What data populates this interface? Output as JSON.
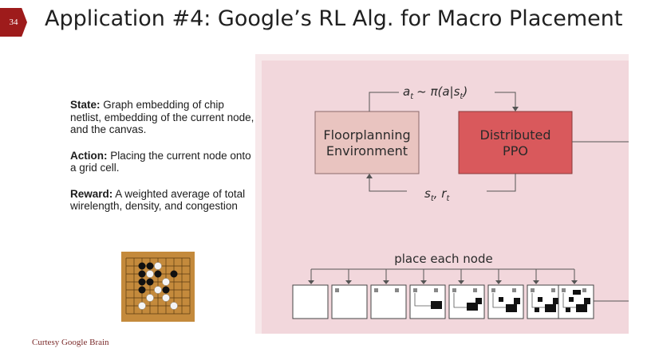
{
  "slide": {
    "number": "34",
    "title": "Application #4: Google’s RL Alg. for Macro Placement",
    "credit": "Curtesy Google Brain"
  },
  "definitions": {
    "state": {
      "label": "State:",
      "text": " Graph embedding of chip netlist, embedding of the current node, and the canvas."
    },
    "action": {
      "label": "Action:",
      "text": " Placing the current node onto a grid cell."
    },
    "reward": {
      "label": "Reward:",
      "text": " A weighted average of total wirelength, density, and congestion"
    }
  },
  "diagram": {
    "env_line1": "Floorplanning",
    "env_line2": "Environment",
    "ppo_line1": "Distributed",
    "ppo_line2": "PPO",
    "action_label": "a",
    "action_sub": "t",
    "policy_text": "~ π(a|s",
    "policy_sub": "t",
    "policy_close": ")",
    "state_label": "s",
    "state_sub": "t",
    "reward_sep": ", r",
    "reward_sub": "t",
    "place_label": "place each node"
  },
  "colors": {
    "slide_badge": "#9e1b1b",
    "diagram_bg": "#f2d7dc",
    "env_box": "#e9c4c0",
    "ppo_box": "#d9595c"
  },
  "icons": [
    "go-board-icon",
    "chip-canvas-icon"
  ]
}
